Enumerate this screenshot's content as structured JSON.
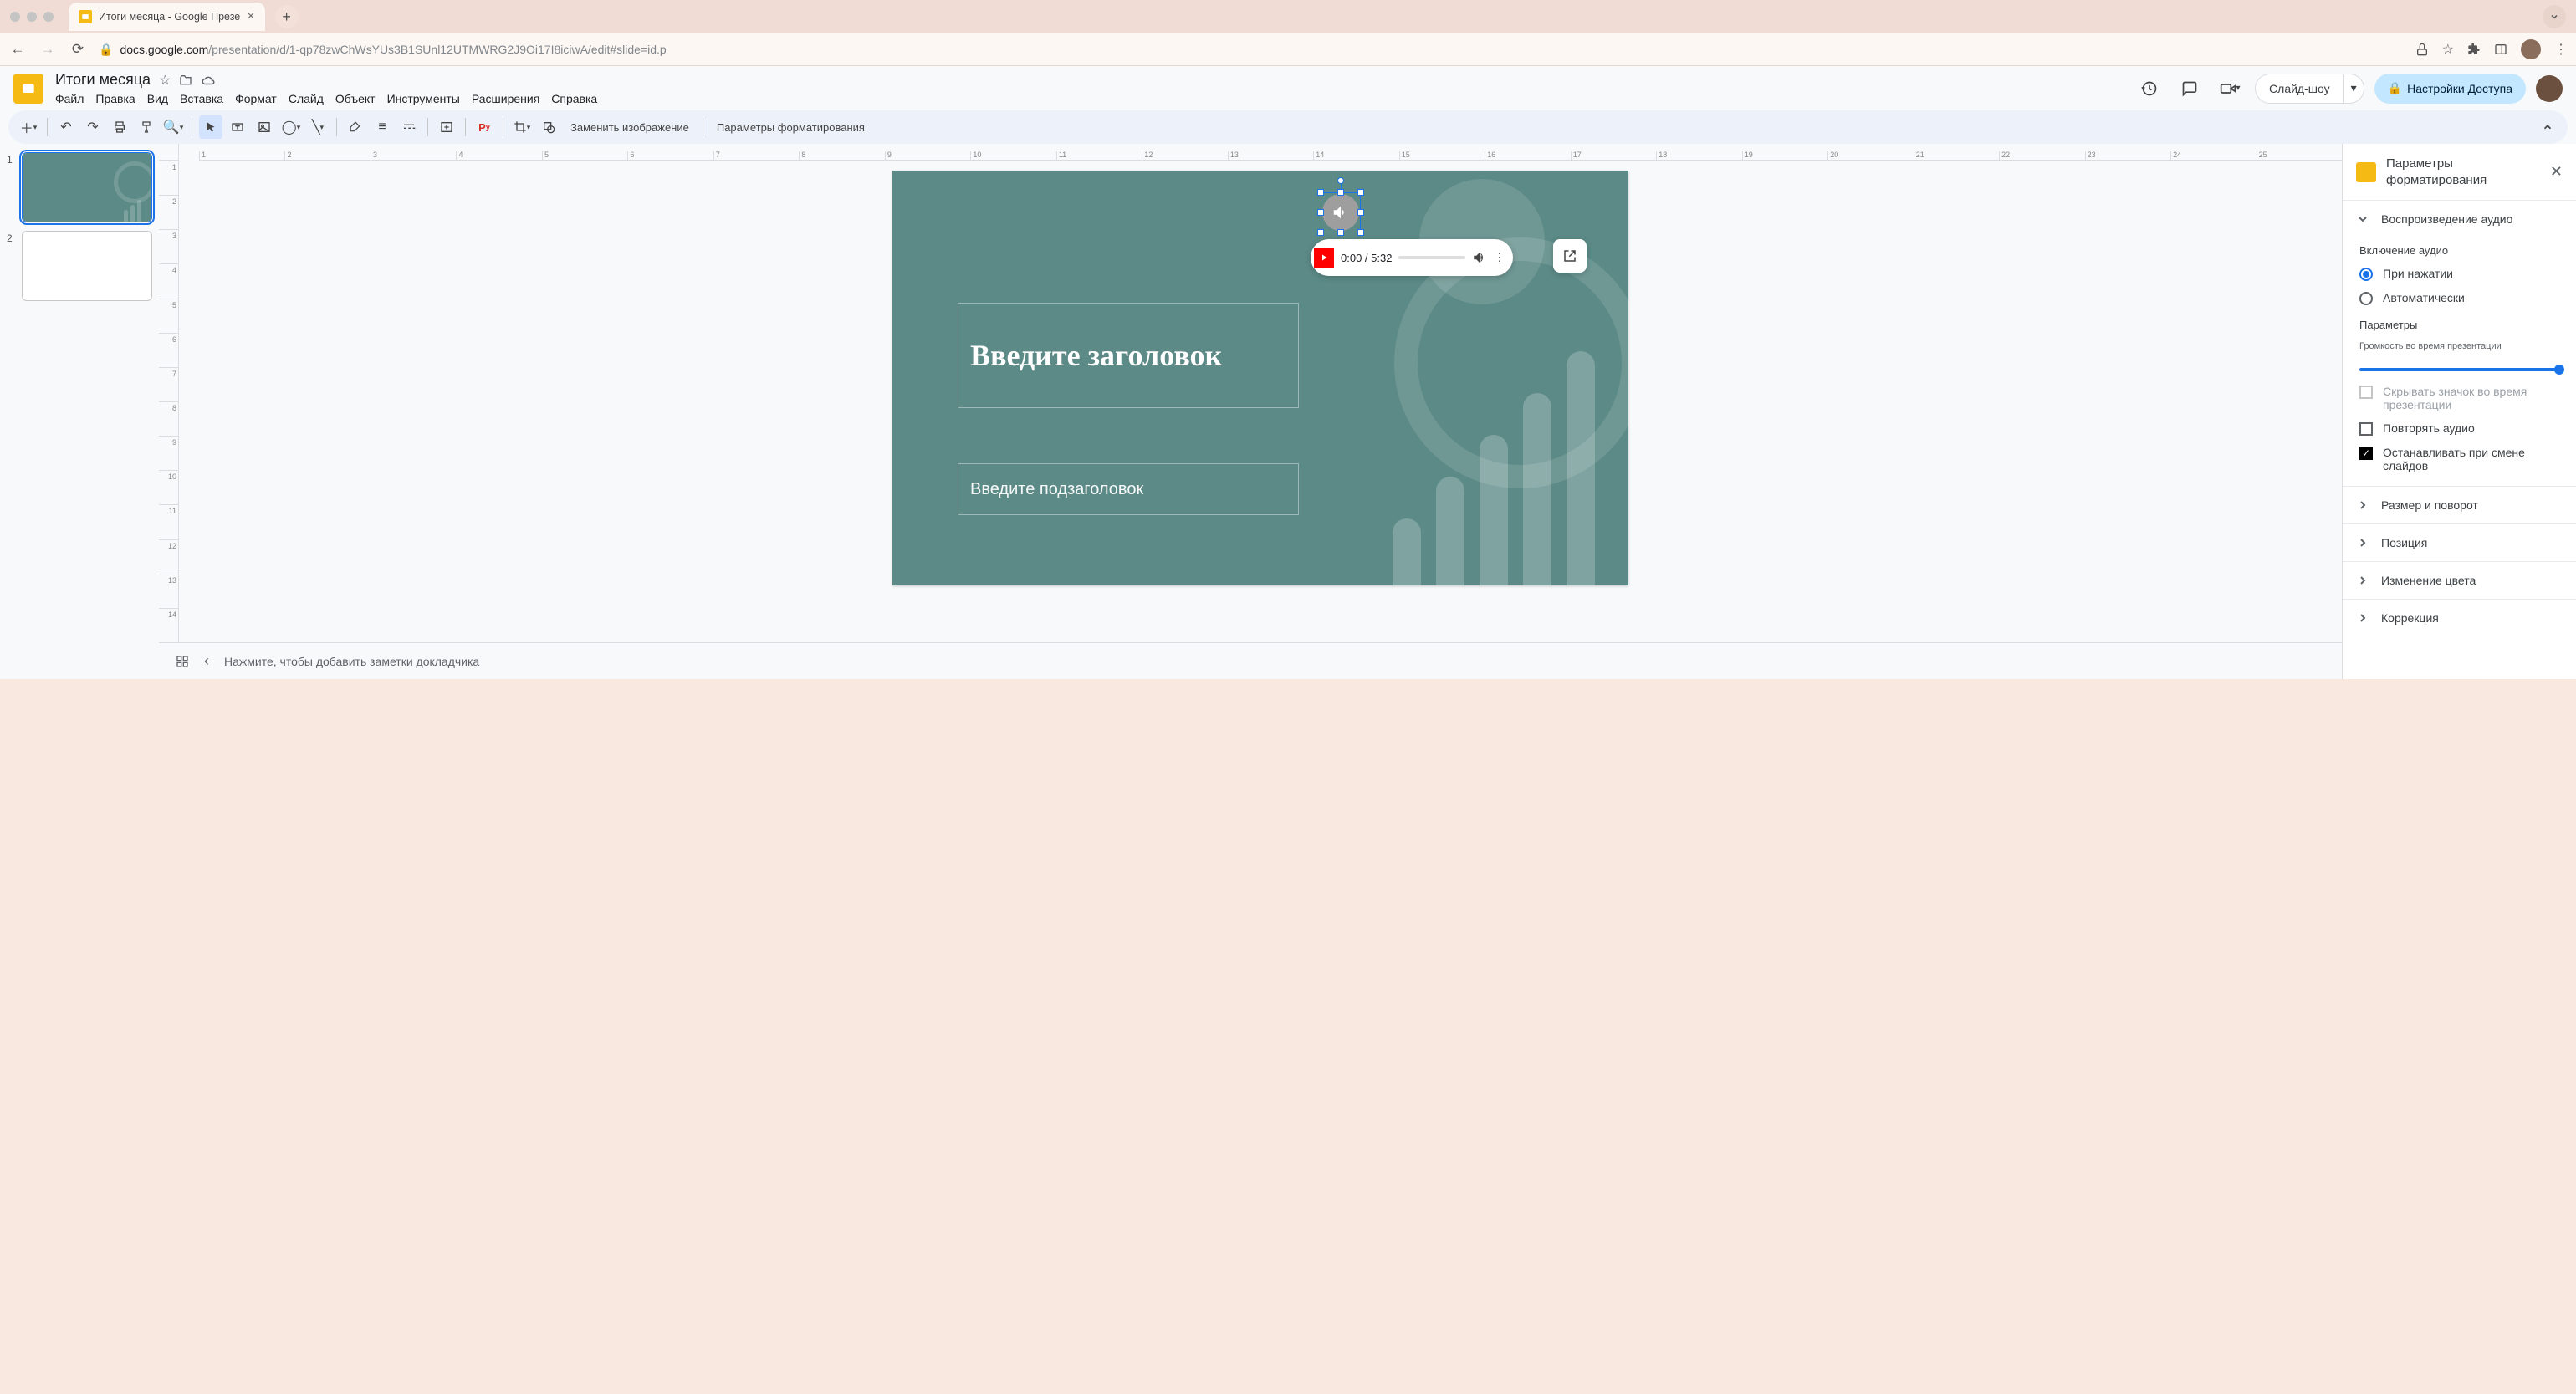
{
  "browser": {
    "tab_title": "Итоги месяца - Google Презе",
    "url_host": "docs.google.com",
    "url_path": "/presentation/d/1-qp78zwChWsYUs3B1SUnl12UTMWRG2J9Oi17I8iciwA/edit#slide=id.p"
  },
  "doc": {
    "name": "Итоги месяца"
  },
  "menu": [
    "Файл",
    "Правка",
    "Вид",
    "Вставка",
    "Формат",
    "Слайд",
    "Объект",
    "Инструменты",
    "Расширения",
    "Справка"
  ],
  "header_buttons": {
    "slideshow": "Слайд-шоу",
    "share": "Настройки Доступа"
  },
  "toolbar_text": {
    "replace_image": "Заменить изображение",
    "format_options": "Параметры форматирования"
  },
  "ruler_h": [
    "1",
    "2",
    "3",
    "4",
    "5",
    "6",
    "7",
    "8",
    "9",
    "10",
    "11",
    "12",
    "13",
    "14",
    "15",
    "16",
    "17",
    "18",
    "19",
    "20",
    "21",
    "22",
    "23",
    "24",
    "25"
  ],
  "ruler_v": [
    "1",
    "2",
    "3",
    "4",
    "5",
    "6",
    "7",
    "8",
    "9",
    "10",
    "11",
    "12",
    "13",
    "14"
  ],
  "slide": {
    "title_placeholder": "Введите заголовок",
    "subtitle_placeholder": "Введите подзаголовок",
    "audio_time": "0:00 / 5:32"
  },
  "thumbs": [
    "1",
    "2"
  ],
  "sidebar": {
    "title": "Параметры форматирования",
    "sec_audio": "Воспроизведение аудио",
    "sub_start": "Включение аудио",
    "radio_click": "При нажатии",
    "radio_auto": "Автоматически",
    "sub_options": "Параметры",
    "volume_label": "Громкость во время презентации",
    "chk_hide": "Скрывать значок во время презентации",
    "chk_loop": "Повторять аудио",
    "chk_stop": "Останавливать при смене слайдов",
    "sec_size": "Размер и поворот",
    "sec_position": "Позиция",
    "sec_recolor": "Изменение цвета",
    "sec_adjust": "Коррекция"
  },
  "notes_placeholder": "Нажмите, чтобы добавить заметки докладчика"
}
